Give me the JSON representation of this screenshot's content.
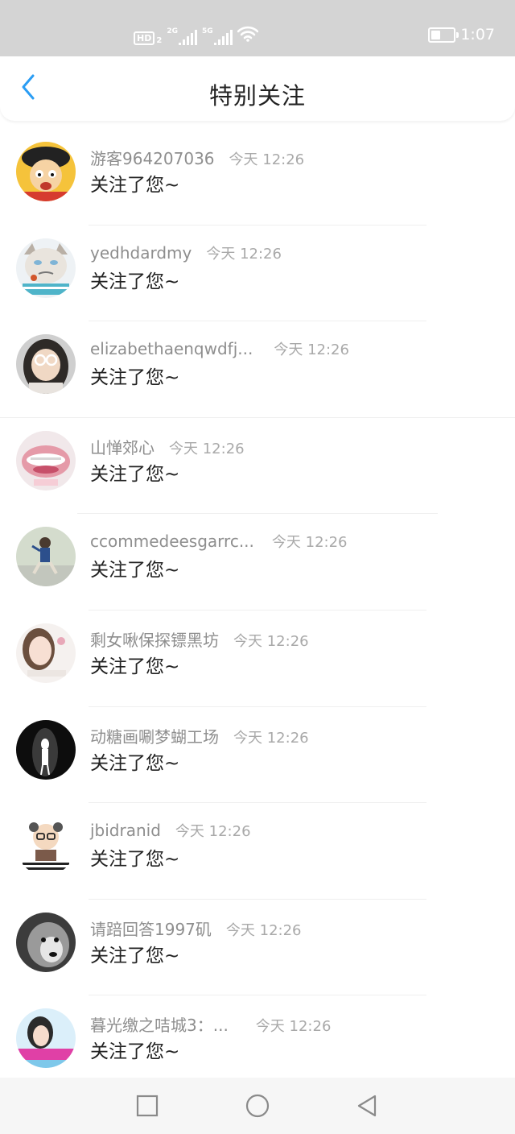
{
  "status_bar": {
    "hd_label": "HD",
    "hd_sub": "2",
    "net1": "2G",
    "net2": "5G",
    "time": "1:07"
  },
  "header": {
    "title": "特别关注",
    "back_icon": "chevron-left-icon"
  },
  "list": {
    "items": [
      {
        "name": "游客964207036",
        "time": "今天 12:26",
        "message": "关注了您~"
      },
      {
        "name": "yedhdardmy",
        "time": "今天 12:26",
        "message": "关注了您~"
      },
      {
        "name": "elizabethaenqwdfj...",
        "time": "今天 12:26",
        "message": "关注了您~"
      },
      {
        "name": "山惮郊心",
        "time": "今天 12:26",
        "message": "关注了您~"
      },
      {
        "name": "ccommedeesgarrc...",
        "time": "今天 12:26",
        "message": "关注了您~"
      },
      {
        "name": "剩女啾保探镖黑坊",
        "time": "今天 12:26",
        "message": "关注了您~"
      },
      {
        "name": "动糖画唰梦蝴工场",
        "time": "今天 12:26",
        "message": "关注了您~"
      },
      {
        "name": "jbidranid",
        "time": "今天 12:26",
        "message": "关注了您~"
      },
      {
        "name": "请踣回答1997矶",
        "time": "今天 12:26",
        "message": "关注了您~"
      },
      {
        "name": "暮光缴之咭城3：...",
        "time": "今天 12:26",
        "message": "关注了您~"
      }
    ]
  },
  "navigation": {
    "recent_icon": "square-icon",
    "home_icon": "circle-icon",
    "back_icon": "triangle-back-icon"
  },
  "colors": {
    "accent": "#2a9df4",
    "status_bar_bg": "#d4d4d4",
    "name_text": "#8e8e8e",
    "time_text": "#a9a9a9"
  }
}
